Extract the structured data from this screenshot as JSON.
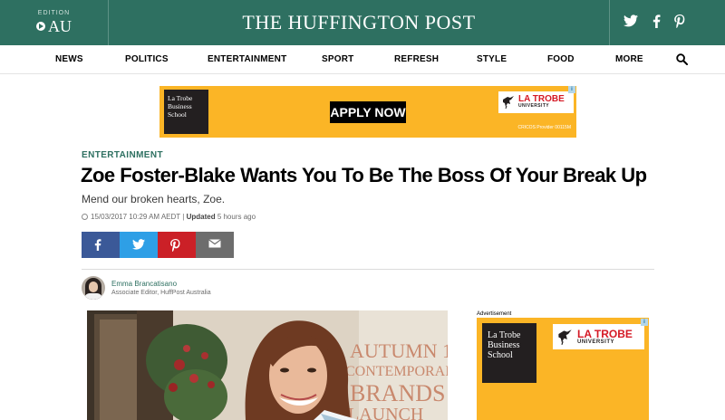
{
  "header": {
    "edition_label": "EDITION",
    "edition_value": "AU",
    "logo": "THE HUFFINGTON POST",
    "brand_color": "#2e7061",
    "social_icons": [
      "twitter-icon",
      "facebook-icon",
      "pinterest-icon"
    ]
  },
  "nav": {
    "items": [
      "NEWS",
      "POLITICS",
      "ENTERTAINMENT",
      "SPORT",
      "REFRESH",
      "STYLE",
      "FOOD",
      "MORE"
    ],
    "search_icon": "search-icon"
  },
  "ad_top": {
    "brand_box": "La Trobe\nBusiness\nSchool",
    "cta": "APPLY NOW",
    "university_name": "LA TROBE",
    "university_sub": "UNIVERSITY",
    "cricos": "CRICOS Provider 00115M",
    "background": "#fbb526"
  },
  "article": {
    "section": "ENTERTAINMENT",
    "headline": "Zoe Foster-Blake Wants You To Be The Boss Of Your Break Up",
    "subhead": "Mend our broken hearts, Zoe.",
    "published": "15/03/2017 10:29 AM AEDT",
    "updated_label": "Updated",
    "updated_value": "5 hours ago"
  },
  "share": [
    {
      "name": "facebook",
      "color": "#3b5998"
    },
    {
      "name": "twitter",
      "color": "#2e9fe6"
    },
    {
      "name": "pinterest",
      "color": "#cb2027"
    },
    {
      "name": "email",
      "color": "#6d6d6d"
    }
  ],
  "author": {
    "name": "Emma Brancatisano",
    "role": "Associate Editor, HuffPost Australia"
  },
  "hero": {
    "backdrop_text": [
      "AUTUMN 1",
      "CONTEMPORAI",
      "BRANDS",
      "LAUNCH"
    ]
  },
  "ad_side": {
    "label": "Advertisement",
    "brand_box": "La Trobe\nBusiness\nSchool",
    "university_name": "LA TROBE",
    "university_sub": "UNIVERSITY"
  }
}
